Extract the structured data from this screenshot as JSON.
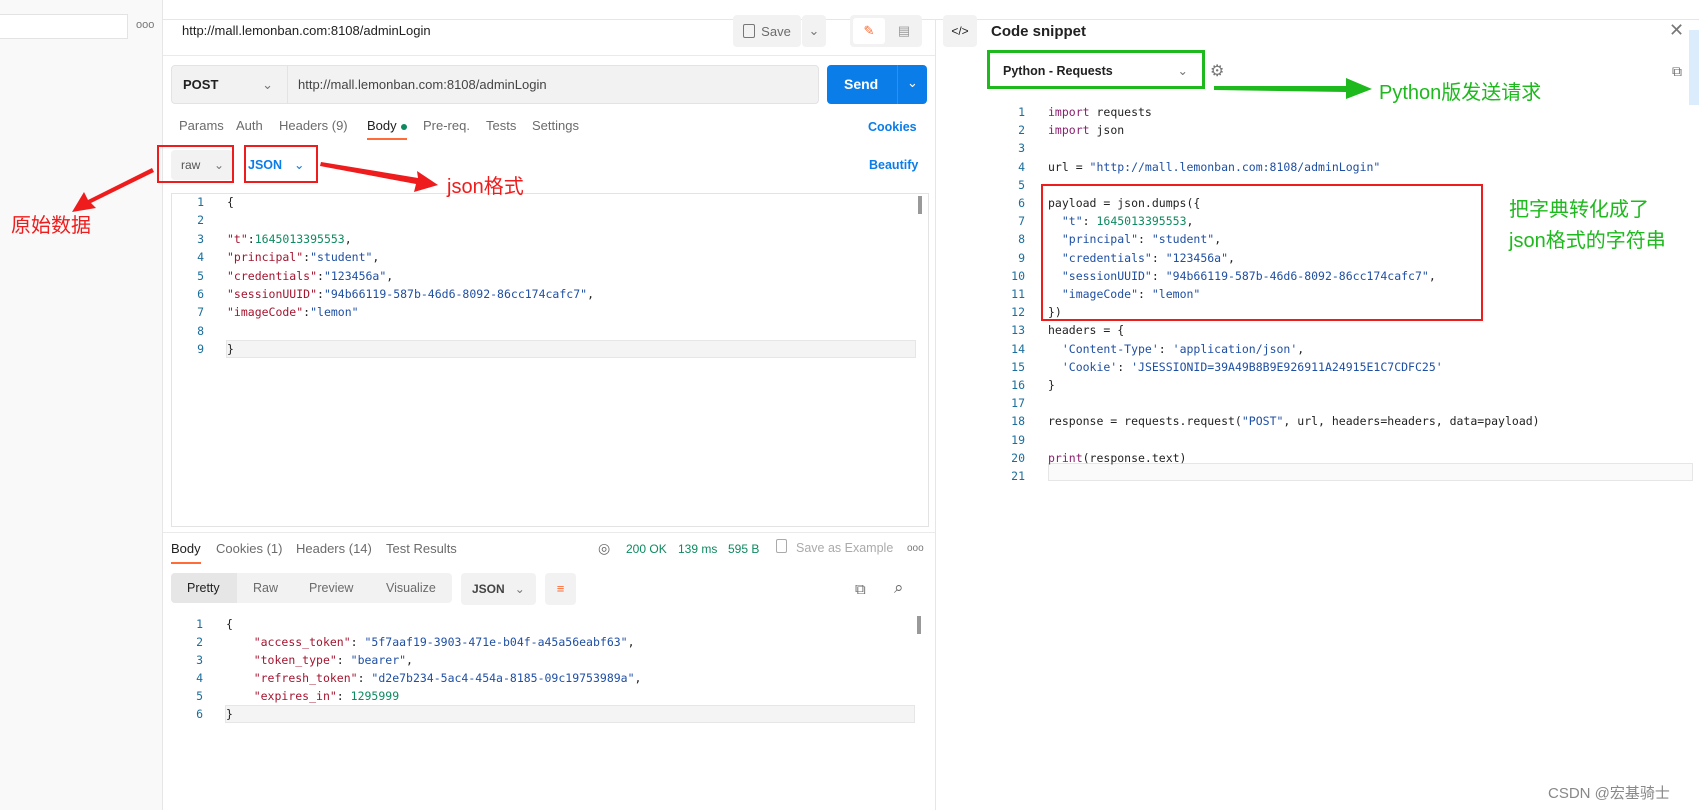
{
  "colors": {
    "accent": "#0b7de8",
    "tab_underline": "#ff6c37",
    "status_green": "#0e8a5f",
    "annotation_red": "#ee1c1c",
    "annotation_green": "#1db91d"
  },
  "request": {
    "title": "http://mall.lemonban.com:8108/adminLogin",
    "save_label": "Save",
    "method": "POST",
    "url": "http://mall.lemonban.com:8108/adminLogin",
    "send_label": "Send",
    "tabs": [
      "Params",
      "Auth",
      "Headers (9)",
      "Body",
      "Pre-req.",
      "Tests",
      "Settings"
    ],
    "cookies_label": "Cookies",
    "body_mode": "raw",
    "body_format": "JSON",
    "beautify_label": "Beautify",
    "body_lines": [
      [
        {
          "c": "p",
          "t": "{"
        }
      ],
      [],
      [
        {
          "c": "k",
          "t": "\"t\""
        },
        {
          "c": "p",
          "t": ":"
        },
        {
          "c": "n",
          "t": "1645013395553"
        },
        {
          "c": "p",
          "t": ","
        }
      ],
      [
        {
          "c": "k",
          "t": "\"principal\""
        },
        {
          "c": "p",
          "t": ":"
        },
        {
          "c": "s",
          "t": "\"student\""
        },
        {
          "c": "p",
          "t": ","
        }
      ],
      [
        {
          "c": "k",
          "t": "\"credentials\""
        },
        {
          "c": "p",
          "t": ":"
        },
        {
          "c": "s",
          "t": "\"123456a\""
        },
        {
          "c": "p",
          "t": ","
        }
      ],
      [
        {
          "c": "k",
          "t": "\"sessionUUID\""
        },
        {
          "c": "p",
          "t": ":"
        },
        {
          "c": "s",
          "t": "\"94b66119-587b-46d6-8092-86cc174cafc7\""
        },
        {
          "c": "p",
          "t": ","
        }
      ],
      [
        {
          "c": "k",
          "t": "\"imageCode\""
        },
        {
          "c": "p",
          "t": ":"
        },
        {
          "c": "s",
          "t": "\"lemon\""
        }
      ],
      [],
      [
        {
          "c": "p",
          "t": "}"
        }
      ]
    ]
  },
  "response": {
    "tabs": [
      "Body",
      "Cookies (1)",
      "Headers (14)",
      "Test Results"
    ],
    "status": "200 OK",
    "time": "139 ms",
    "size": "595 B",
    "save_example": "Save as Example",
    "view_tabs": [
      "Pretty",
      "Raw",
      "Preview",
      "Visualize"
    ],
    "format": "JSON",
    "lines": [
      [
        {
          "c": "p",
          "t": "{"
        }
      ],
      [
        {
          "c": "p",
          "t": "    "
        },
        {
          "c": "k",
          "t": "\"access_token\""
        },
        {
          "c": "p",
          "t": ": "
        },
        {
          "c": "s",
          "t": "\"5f7aaf19-3903-471e-b04f-a45a56eabf63\""
        },
        {
          "c": "p",
          "t": ","
        }
      ],
      [
        {
          "c": "p",
          "t": "    "
        },
        {
          "c": "k",
          "t": "\"token_type\""
        },
        {
          "c": "p",
          "t": ": "
        },
        {
          "c": "s",
          "t": "\"bearer\""
        },
        {
          "c": "p",
          "t": ","
        }
      ],
      [
        {
          "c": "p",
          "t": "    "
        },
        {
          "c": "k",
          "t": "\"refresh_token\""
        },
        {
          "c": "p",
          "t": ": "
        },
        {
          "c": "s",
          "t": "\"d2e7b234-5ac4-454a-8185-09c19753989a\""
        },
        {
          "c": "p",
          "t": ","
        }
      ],
      [
        {
          "c": "p",
          "t": "    "
        },
        {
          "c": "k",
          "t": "\"expires_in\""
        },
        {
          "c": "p",
          "t": ": "
        },
        {
          "c": "n",
          "t": "1295999"
        }
      ],
      [
        {
          "c": "p",
          "t": "}"
        }
      ]
    ]
  },
  "snippet": {
    "title": "Code snippet",
    "language": "Python - Requests",
    "lines": [
      [
        {
          "c": "kw",
          "t": "import"
        },
        {
          "c": "p",
          "t": " requests"
        }
      ],
      [
        {
          "c": "kw",
          "t": "import"
        },
        {
          "c": "p",
          "t": " json"
        }
      ],
      [],
      [
        {
          "c": "p",
          "t": "url = "
        },
        {
          "c": "s",
          "t": "\"http://mall.lemonban.com:8108/adminLogin\""
        }
      ],
      [],
      [
        {
          "c": "p",
          "t": "payload = json.dumps({"
        }
      ],
      [
        {
          "c": "s",
          "t": "  \"t\""
        },
        {
          "c": "p",
          "t": ": "
        },
        {
          "c": "n",
          "t": "1645013395553"
        },
        {
          "c": "p",
          "t": ","
        }
      ],
      [
        {
          "c": "s",
          "t": "  \"principal\""
        },
        {
          "c": "p",
          "t": ": "
        },
        {
          "c": "s",
          "t": "\"student\""
        },
        {
          "c": "p",
          "t": ","
        }
      ],
      [
        {
          "c": "s",
          "t": "  \"credentials\""
        },
        {
          "c": "p",
          "t": ": "
        },
        {
          "c": "s",
          "t": "\"123456a\""
        },
        {
          "c": "p",
          "t": ","
        }
      ],
      [
        {
          "c": "s",
          "t": "  \"sessionUUID\""
        },
        {
          "c": "p",
          "t": ": "
        },
        {
          "c": "s",
          "t": "\"94b66119-587b-46d6-8092-86cc174cafc7\""
        },
        {
          "c": "p",
          "t": ","
        }
      ],
      [
        {
          "c": "s",
          "t": "  \"imageCode\""
        },
        {
          "c": "p",
          "t": ": "
        },
        {
          "c": "s",
          "t": "\"lemon\""
        }
      ],
      [
        {
          "c": "p",
          "t": "})"
        }
      ],
      [
        {
          "c": "p",
          "t": "headers = {"
        }
      ],
      [
        {
          "c": "s",
          "t": "  'Content-Type'"
        },
        {
          "c": "p",
          "t": ": "
        },
        {
          "c": "s",
          "t": "'application/json'"
        },
        {
          "c": "p",
          "t": ","
        }
      ],
      [
        {
          "c": "s",
          "t": "  'Cookie'"
        },
        {
          "c": "p",
          "t": ": "
        },
        {
          "c": "s",
          "t": "'JSESSIONID=39A49B8B9E926911A24915E1C7CDFC25'"
        }
      ],
      [
        {
          "c": "p",
          "t": "}"
        }
      ],
      [],
      [
        {
          "c": "p",
          "t": "response = requests.request("
        },
        {
          "c": "s",
          "t": "\"POST\""
        },
        {
          "c": "p",
          "t": ", url, headers=headers, data=payload)"
        }
      ],
      [],
      [
        {
          "c": "kw",
          "t": "print"
        },
        {
          "c": "p",
          "t": "(response.text)"
        }
      ],
      []
    ]
  },
  "annotations": {
    "raw": "原始数据",
    "json": "json格式",
    "python": "Python版发送请求",
    "payload_1": "把字典转化成了",
    "payload_2": "json格式的字符串"
  },
  "watermark": "CSDN @宏基骑士"
}
